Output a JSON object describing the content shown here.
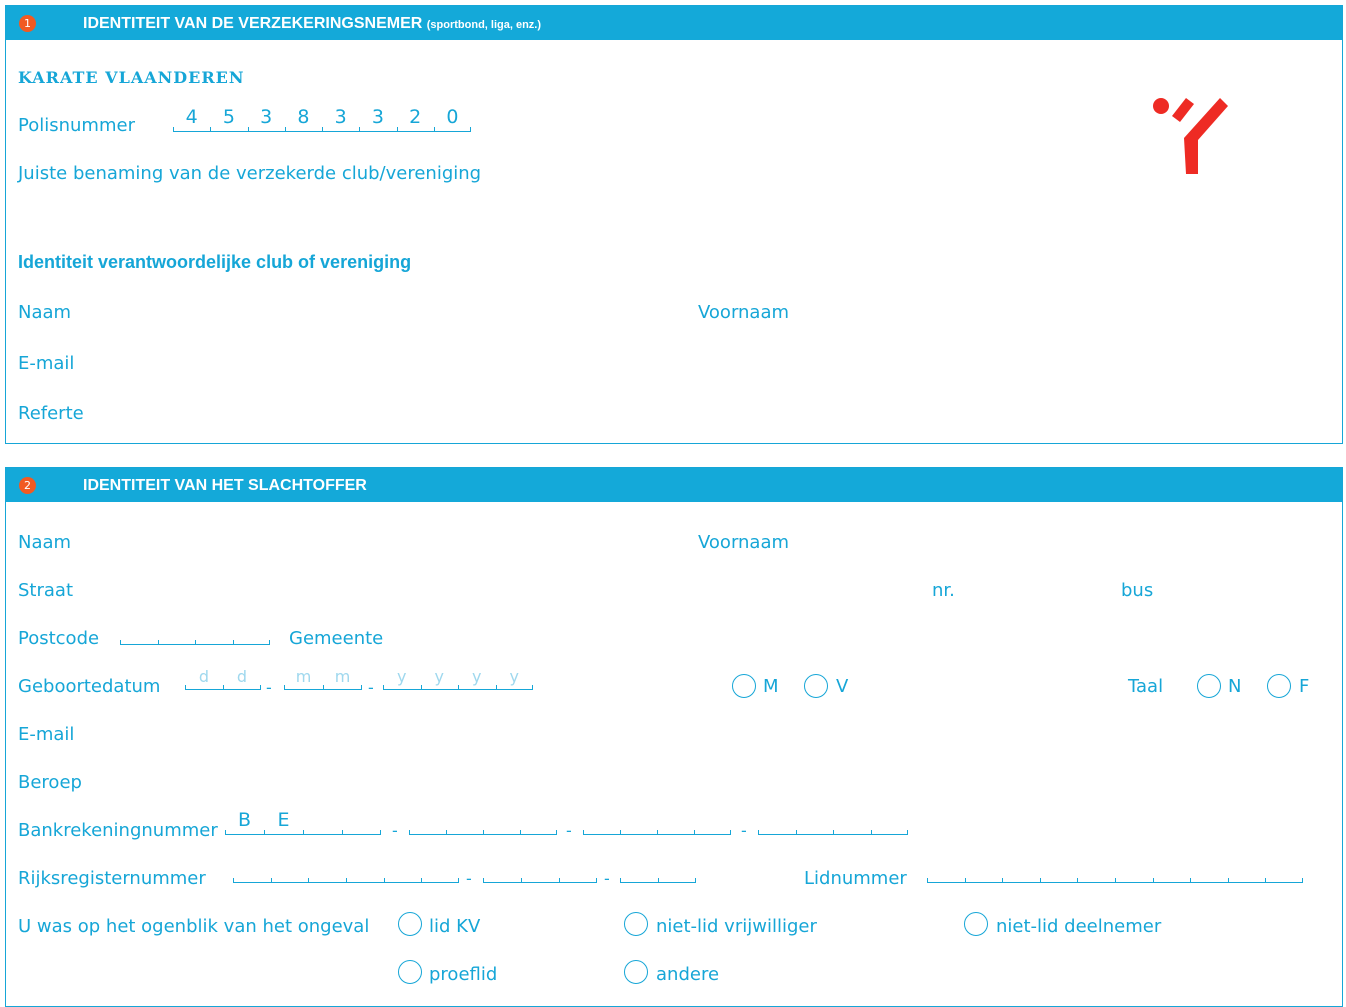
{
  "section1": {
    "number": "1",
    "title": "IDENTITEIT VAN DE VERZEKERINGSNEMER",
    "title_small": "(sportbond, liga, enz.)",
    "org_name": "KARATE VLAANDEREN",
    "policy_label": "Polisnummer",
    "policy_digits": [
      "4",
      "5",
      "3",
      "8",
      "3",
      "3",
      "2",
      "0"
    ],
    "club_name_label": "Juiste benaming van de verzekerde club/vereniging",
    "resp_heading": "Identiteit verantwoordelijke club of vereniging",
    "naam_label": "Naam",
    "voornaam_label": "Voornaam",
    "email_label": "E-mail",
    "referte_label": "Referte"
  },
  "section2": {
    "number": "2",
    "title": "IDENTITEIT VAN HET SLACHTOFFER",
    "naam_label": "Naam",
    "voornaam_label": "Voornaam",
    "straat_label": "Straat",
    "nr_label": "nr.",
    "bus_label": "bus",
    "postcode_label": "Postcode",
    "gemeente_label": "Gemeente",
    "geboortedatum_label": "Geboortedatum",
    "date_placeholders": {
      "day": [
        "d",
        "d"
      ],
      "month": [
        "m",
        "m"
      ],
      "year": [
        "y",
        "y",
        "y",
        "y"
      ]
    },
    "gender_options": [
      "M",
      "V"
    ],
    "taal_label": "Taal",
    "taal_options": [
      "N",
      "F"
    ],
    "email_label": "E-mail",
    "beroep_label": "Beroep",
    "bank_label": "Bankrekeningnummer",
    "bank_prefix": [
      "B",
      "E"
    ],
    "rijks_label": "Rijksregisternummer",
    "lid_label": "Lidnummer",
    "status_label": "U was op het ogenblik van het ongeval",
    "status_options": [
      "lid KV",
      "niet-lid vrijwilliger",
      "niet-lid deelnemer",
      "proeflid",
      "andere"
    ]
  },
  "colors": {
    "accent": "#14a9d9",
    "badge": "#f15a22",
    "logo": "#ee2b24",
    "placeholder": "#9fd8ee"
  }
}
